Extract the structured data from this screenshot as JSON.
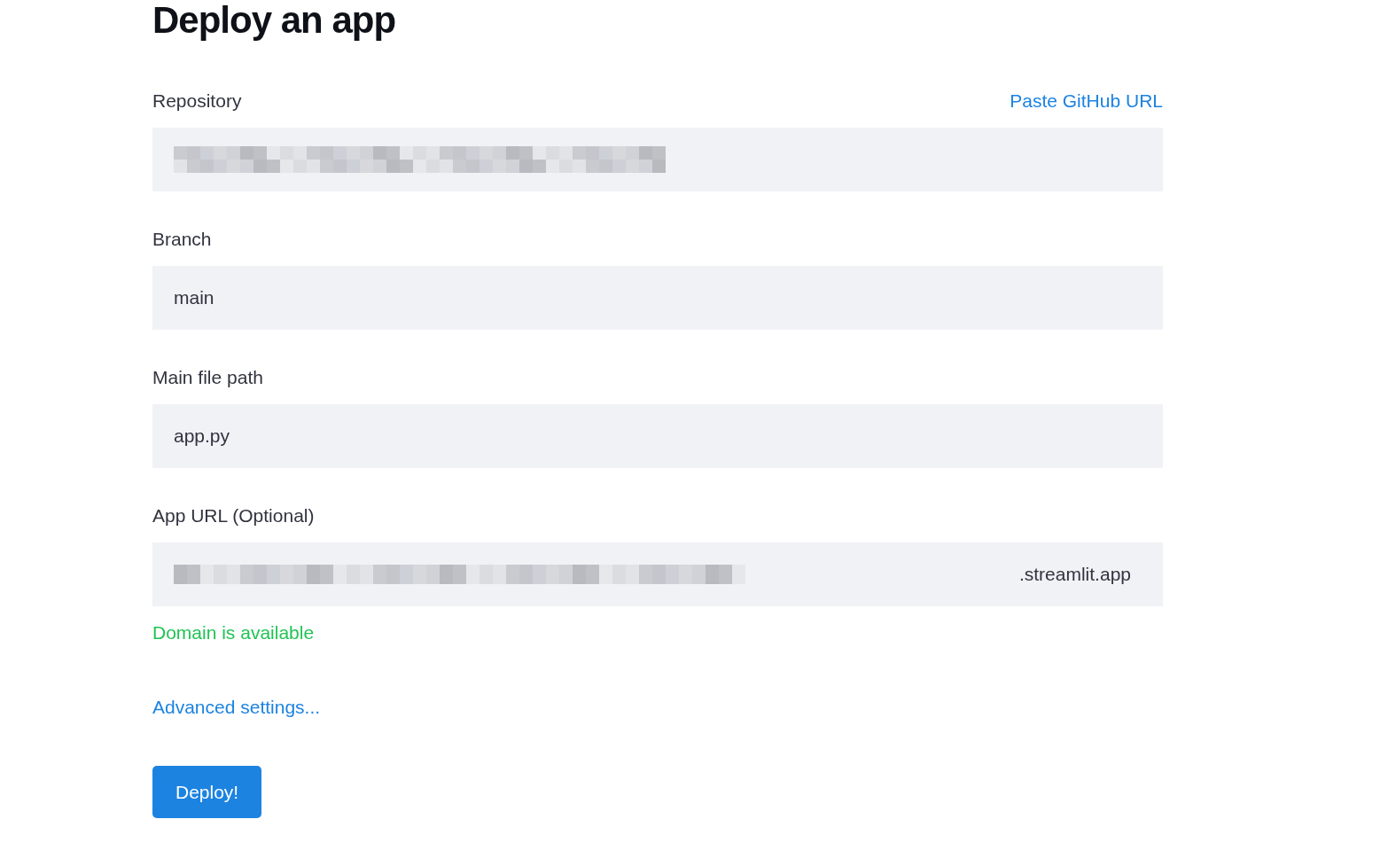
{
  "title": "Deploy an app",
  "fields": [
    {
      "label": "Repository",
      "link": "Paste GitHub URL",
      "redacted": true
    },
    {
      "label": "Branch",
      "value": "main"
    },
    {
      "label": "Main file path",
      "value": "app.py"
    },
    {
      "label": "App URL (Optional)",
      "redacted": true,
      "suffix": ".streamlit.app",
      "status": {
        "text": "Domain is available",
        "kind": "success"
      }
    }
  ],
  "advanced_link": "Advanced settings...",
  "deploy_button": "Deploy!"
}
